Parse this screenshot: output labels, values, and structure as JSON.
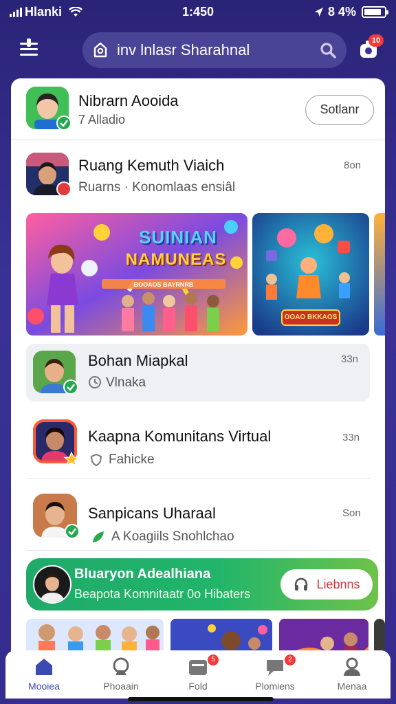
{
  "status_bar": {
    "carrier": "Hlanki",
    "time": "1:450",
    "battery_text": "8 4%",
    "battery_level": 0.84
  },
  "header": {
    "search_text": "inv lnlasr Sharahnal",
    "notification_count": "10"
  },
  "feed": {
    "suggested": {
      "name": "Nibrarn Aooida",
      "subtitle": "7 Alladio",
      "follow_label": "Sotlanr"
    },
    "post": {
      "name": "Ruang Kemuth Viaich",
      "subtitle": "Ruarns · Konomlaas ensiâl",
      "time": "8on"
    },
    "banner": {
      "title_line1": "SUINIAN",
      "title_line2": "NAMUNEAS",
      "caption": "BOOAOS BAYRNRB",
      "second_cta": "OOAO BKKAOS"
    },
    "items": [
      {
        "name": "Bohan Miapkal",
        "subtitle": "Vlnaka",
        "time": "33n",
        "badge": "green-check"
      },
      {
        "name": "Kaapna Komunitans Virtual",
        "subtitle": "Fahicke",
        "time": "33n",
        "badge": "gold-star"
      },
      {
        "name": "Sanpicans Uharaal",
        "subtitle": "A Koagiils Snohlchao",
        "time": "Son",
        "badge": "green-check"
      }
    ],
    "promo": {
      "title": "Bluaryon Adealhiana",
      "subtitle": "Beapota Komnitaatr 0o Hibaters",
      "button_label": "Liebnns"
    }
  },
  "bottom_nav": {
    "items": [
      {
        "label": "Mooiea",
        "icon": "home-icon",
        "active": true
      },
      {
        "label": "Phoaain",
        "icon": "chat-icon",
        "badge": ""
      },
      {
        "label": "Fold",
        "icon": "inbox-icon",
        "badge": "5"
      },
      {
        "label": "Plomiens",
        "icon": "message-icon",
        "badge": "2"
      },
      {
        "label": "Menaa",
        "icon": "profile-icon"
      }
    ]
  },
  "colors": {
    "background_top": "#2a2477",
    "accent": "#3b4bb0",
    "promo_green": "#22b56a",
    "badge_red": "#ef3b3b"
  }
}
